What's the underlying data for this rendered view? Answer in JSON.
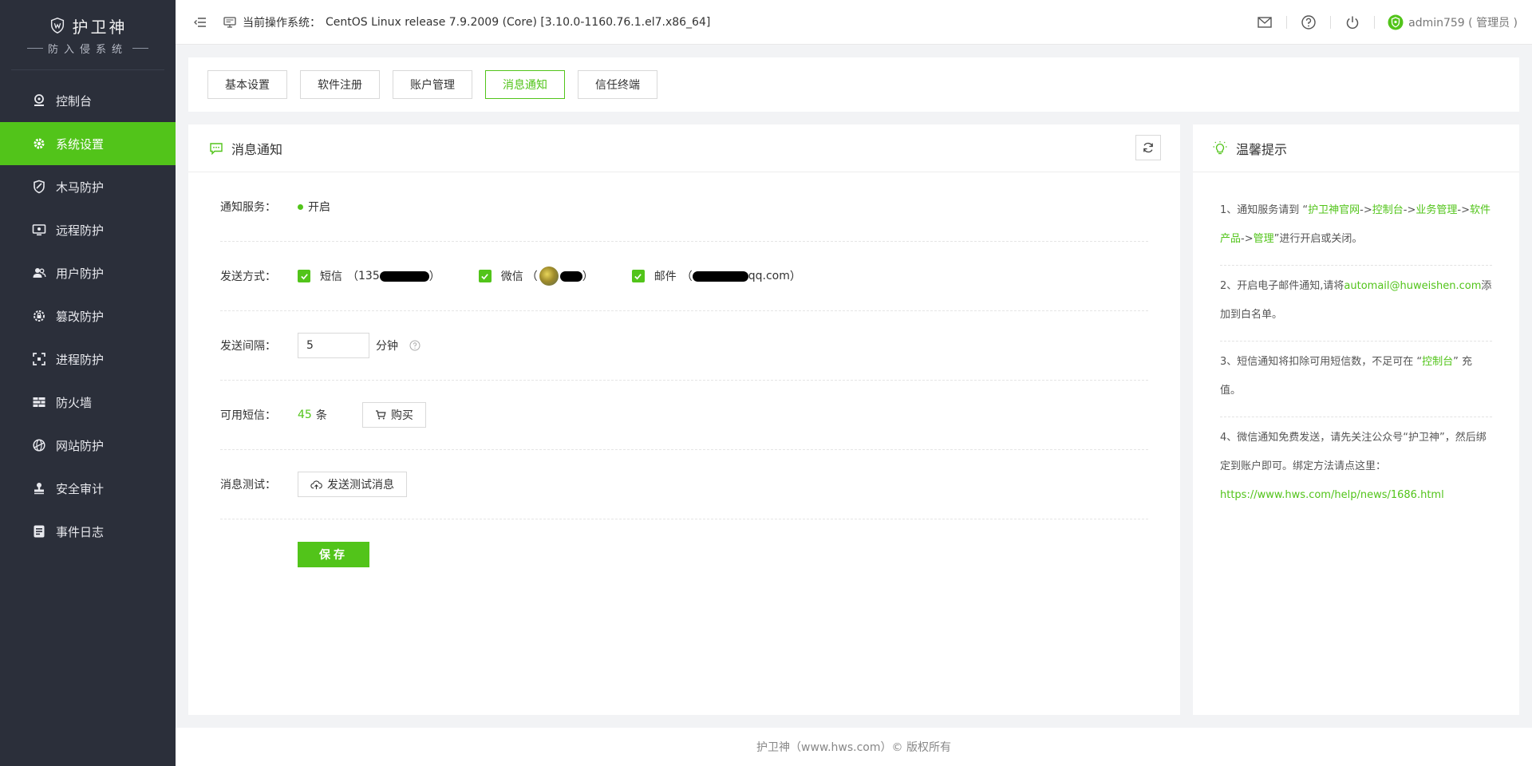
{
  "brand": {
    "name": "护卫神",
    "subtitle": "防入侵系统"
  },
  "sidebar": {
    "items": [
      {
        "label": "控制台",
        "icon": "dashboard-icon",
        "active": false
      },
      {
        "label": "系统设置",
        "icon": "gear-icon",
        "active": true
      },
      {
        "label": "木马防护",
        "icon": "shield-icon",
        "active": false
      },
      {
        "label": "远程防护",
        "icon": "remote-desktop-icon",
        "active": false
      },
      {
        "label": "用户防护",
        "icon": "users-icon",
        "active": false
      },
      {
        "label": "篡改防护",
        "icon": "gear-lock-icon",
        "active": false
      },
      {
        "label": "进程防护",
        "icon": "process-frame-icon",
        "active": false
      },
      {
        "label": "防火墙",
        "icon": "brick-wall-icon",
        "active": false
      },
      {
        "label": "网站防护",
        "icon": "globe-shield-icon",
        "active": false
      },
      {
        "label": "安全审计",
        "icon": "stamp-icon",
        "active": false
      },
      {
        "label": "事件日志",
        "icon": "log-icon",
        "active": false
      }
    ]
  },
  "header": {
    "os_label": "当前操作系统：",
    "os_value": "CentOS Linux release 7.9.2009 (Core) [3.10.0-1160.76.1.el7.x86_64]",
    "user": "admin759 ( 管理员 )"
  },
  "tabs": [
    {
      "label": "基本设置",
      "active": false
    },
    {
      "label": "软件注册",
      "active": false
    },
    {
      "label": "账户管理",
      "active": false
    },
    {
      "label": "消息通知",
      "active": true
    },
    {
      "label": "信任终端",
      "active": false
    }
  ],
  "panel": {
    "title": "消息通知",
    "service_label": "通知服务：",
    "service_status": "开启",
    "send_label": "发送方式：",
    "sms_label": "短信",
    "sms_open": "（",
    "sms_prefix": "135",
    "sms_close": "）",
    "wechat_label": "微信",
    "wechat_open": "（",
    "wechat_close": "）",
    "mail_label": "邮件",
    "mail_open": "（",
    "mail_suffix": "qq.com",
    "mail_close": "）",
    "interval_label": "发送间隔：",
    "interval_value": "5",
    "interval_unit": "分钟",
    "sms_avail_label": "可用短信：",
    "sms_avail_count": "45",
    "sms_avail_unit": "条",
    "buy_label": "购买",
    "test_label": "消息测试：",
    "test_button": "发送测试消息",
    "save_label": "保存"
  },
  "tips": {
    "title": "温馨提示",
    "t1_a": "1、通知服务请到 “",
    "t1_l1": "护卫神官网",
    "t1_s1": "->",
    "t1_l2": "控制台",
    "t1_s2": "->",
    "t1_l3": "业务管理",
    "t1_s3": "->",
    "t1_l4": "软件产品",
    "t1_s4": "->",
    "t1_l5": "管理",
    "t1_b": "”进行开启或关闭。",
    "t2_a": "2、开启电子邮件通知,请将",
    "t2_email": "automail@huweishen.com",
    "t2_b": "添加到白名单。",
    "t3_a": "3、短信通知将扣除可用短信数，不足可在 “",
    "t3_link": "控制台",
    "t3_b": "” 充值。",
    "t4_a": "4、微信通知免费发送，请先关注公众号“护卫神”，然后绑定到账户即可。绑定方法请点这里：",
    "t4_url": "https://www.hws.com/help/news/1686.html"
  },
  "footer": {
    "text": "护卫神（www.hws.com）© 版权所有"
  },
  "colors": {
    "accent": "#52c41a",
    "sidebar_bg": "#2b2f3a"
  }
}
